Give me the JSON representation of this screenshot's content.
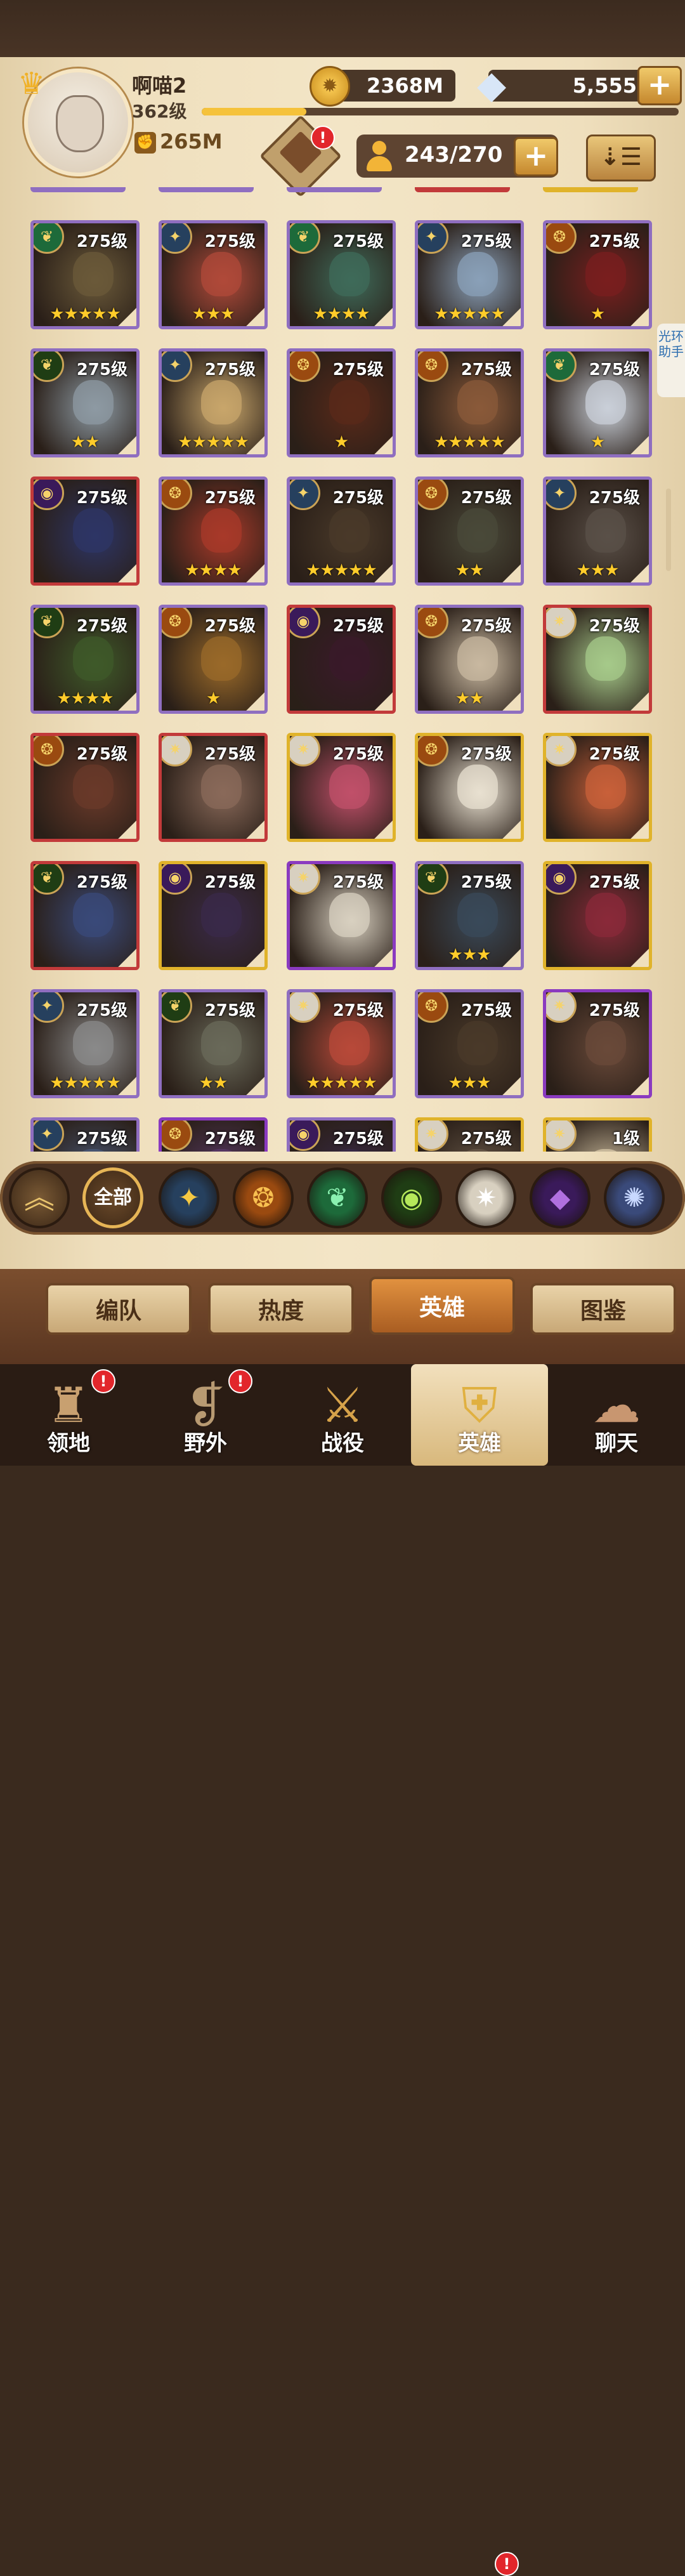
{
  "header": {
    "username": "啊喵2",
    "level": "362级",
    "xp_fraction": 0.22,
    "gold": "2368M",
    "gems": "5,555",
    "power": "265M",
    "hero_capacity": "243/270",
    "plus_symbol": "+",
    "alert_symbol": "!",
    "sort_symbol": "⇣☰"
  },
  "side_helper": "光环助手",
  "heroes": [
    {
      "level": "275级",
      "stars": "★★★★★",
      "faction": "verdant",
      "frame": "#8f6ec0",
      "art": "#6b5a3a"
    },
    {
      "level": "275级",
      "stars": "★★★",
      "faction": "celestial-blue",
      "frame": "#8f6ec0",
      "art": "#b04a3a"
    },
    {
      "level": "275级",
      "stars": "★★★★",
      "faction": "verdant",
      "frame": "#8f6ec0",
      "art": "#3f6b5a"
    },
    {
      "level": "275级",
      "stars": "★★★★★",
      "faction": "lightbearer",
      "frame": "#8f6ec0",
      "art": "#8aa0b8"
    },
    {
      "level": "275级",
      "stars": "★",
      "faction": "mauler",
      "frame": "#8f6ec0",
      "art": "#7a1f1f"
    },
    {
      "level": "275级",
      "stars": "★★",
      "faction": "wilder",
      "frame": "#8f6ec0",
      "art": "#8d9aa3"
    },
    {
      "level": "275级",
      "stars": "★★★★★",
      "faction": "lightbearer",
      "frame": "#8f6ec0",
      "art": "#c8a66b"
    },
    {
      "level": "275级",
      "stars": "★",
      "faction": "mauler",
      "frame": "#8f6ec0",
      "art": "#5a2a1a"
    },
    {
      "level": "275级",
      "stars": "★★★★★",
      "faction": "mauler",
      "frame": "#8f6ec0",
      "art": "#8a5a3a"
    },
    {
      "level": "275级",
      "stars": "★",
      "faction": "verdant",
      "frame": "#8f6ec0",
      "art": "#c9cfd8"
    },
    {
      "level": "275级",
      "stars": "",
      "faction": "graveborn",
      "frame": "#c23a3a",
      "art": "#2d3566"
    },
    {
      "level": "275级",
      "stars": "★★★★",
      "faction": "mauler",
      "frame": "#8f6ec0",
      "art": "#a83a2a"
    },
    {
      "level": "275级",
      "stars": "★★★★★",
      "faction": "lightbearer",
      "frame": "#8f6ec0",
      "art": "#4a3a2a"
    },
    {
      "level": "275级",
      "stars": "★★",
      "faction": "mauler",
      "frame": "#8f6ec0",
      "art": "#4a4a3a"
    },
    {
      "level": "275级",
      "stars": "★★★",
      "faction": "lightbearer",
      "frame": "#8f6ec0",
      "art": "#5a5048"
    },
    {
      "level": "275级",
      "stars": "★★★★",
      "faction": "wilder",
      "frame": "#8f6ec0",
      "art": "#3f5a2a"
    },
    {
      "level": "275级",
      "stars": "★",
      "faction": "mauler",
      "frame": "#8f6ec0",
      "art": "#9a6a2a"
    },
    {
      "level": "275级",
      "stars": "",
      "faction": "graveborn",
      "frame": "#c23a3a",
      "art": "#3a1a2a"
    },
    {
      "level": "275级",
      "stars": "★★",
      "faction": "mauler",
      "frame": "#8f6ec0",
      "art": "#c8b8a0"
    },
    {
      "level": "275级",
      "stars": "",
      "faction": "celestial",
      "frame": "#c23a3a",
      "art": "#a6c98a"
    },
    {
      "level": "275级",
      "stars": "",
      "faction": "mauler",
      "frame": "#c23a3a",
      "art": "#6a3a2a"
    },
    {
      "level": "275级",
      "stars": "",
      "faction": "celestial",
      "frame": "#c23a3a",
      "art": "#8a6a5a"
    },
    {
      "level": "275级",
      "stars": "",
      "faction": "celestial",
      "frame": "#e0b32a",
      "art": "#c0506a"
    },
    {
      "level": "275级",
      "stars": "",
      "faction": "mauler",
      "frame": "#e0b32a",
      "art": "#e8e0d0"
    },
    {
      "level": "275级",
      "stars": "",
      "faction": "celestial",
      "frame": "#e0b32a",
      "art": "#c8603a"
    },
    {
      "level": "275级",
      "stars": "",
      "faction": "wilder",
      "frame": "#c23a3a",
      "art": "#3a4a7a"
    },
    {
      "level": "275级",
      "stars": "",
      "faction": "graveborn",
      "frame": "#e0b32a",
      "art": "#3a2a4a"
    },
    {
      "level": "275级",
      "stars": "",
      "faction": "celestial",
      "frame": "#8a3ac0",
      "art": "#d8d0c0"
    },
    {
      "level": "275级",
      "stars": "★★★",
      "faction": "wilder",
      "frame": "#8f6ec0",
      "art": "#3a4a5a"
    },
    {
      "level": "275级",
      "stars": "",
      "faction": "graveborn",
      "frame": "#e0b32a",
      "art": "#8a2a3a"
    },
    {
      "level": "275级",
      "stars": "★★★★★",
      "faction": "lightbearer",
      "frame": "#8f6ec0",
      "art": "#8a8a8a"
    },
    {
      "level": "275级",
      "stars": "★★",
      "faction": "wilder",
      "frame": "#8f6ec0",
      "art": "#6a6a5a"
    },
    {
      "level": "275级",
      "stars": "★★★★★",
      "faction": "celestial",
      "frame": "#8f6ec0",
      "art": "#b84a3a"
    },
    {
      "level": "275级",
      "stars": "★★★",
      "faction": "mauler",
      "frame": "#8f6ec0",
      "art": "#4a3a2a"
    },
    {
      "level": "275级",
      "stars": "",
      "faction": "celestial",
      "frame": "#8a3ac0",
      "art": "#6a4a3a"
    },
    {
      "level": "275级",
      "stars": "",
      "faction": "lightbearer",
      "frame": "#8f6ec0",
      "art": "#4a5a7a"
    },
    {
      "level": "275级",
      "stars": "",
      "faction": "mauler",
      "frame": "#8a3ac0",
      "art": "#5a3a6a"
    },
    {
      "level": "275级",
      "stars": "",
      "faction": "graveborn",
      "frame": "#8f6ec0",
      "art": "#3a2a4a"
    },
    {
      "level": "275级",
      "stars": "",
      "faction": "celestial",
      "frame": "#e0b32a",
      "art": "#6a5a4a"
    },
    {
      "level": "1级",
      "stars": "",
      "faction": "celestial",
      "frame": "#e0b32a",
      "art": "#d8c8a8"
    }
  ],
  "faction_filters": {
    "up": "︽",
    "all_label": "全部",
    "icons": [
      {
        "name": "lightbearer",
        "glyph": "✦",
        "bg": "#26405e",
        "fg": "#f5c842"
      },
      {
        "name": "mauler",
        "glyph": "❂",
        "bg": "#9a4a10",
        "fg": "#f8c050"
      },
      {
        "name": "wilder",
        "glyph": "❦",
        "bg": "#1d6a3a",
        "fg": "#8af0b0"
      },
      {
        "name": "graveborn",
        "glyph": "◉",
        "bg": "#1f3d14",
        "fg": "#b6e85a"
      },
      {
        "name": "celestial",
        "glyph": "✷",
        "bg": "#d8d0c0",
        "fg": "#ffffff"
      },
      {
        "name": "hypogean",
        "glyph": "◆",
        "bg": "#3a1a5a",
        "fg": "#b070e0"
      },
      {
        "name": "dimensional",
        "glyph": "✺",
        "bg": "#3a4a7a",
        "fg": "#c8d8ff"
      }
    ]
  },
  "tabs": [
    "编队",
    "热度",
    "英雄",
    "图鉴"
  ],
  "active_tab": "英雄",
  "nav": [
    {
      "label": "领地",
      "icon": "castle-icon",
      "alert": true
    },
    {
      "label": "野外",
      "icon": "scroll-map-icon",
      "alert": true
    },
    {
      "label": "战役",
      "icon": "crossed-swords-icon",
      "alert": false
    },
    {
      "label": "英雄",
      "icon": "helmet-icon",
      "alert": false
    },
    {
      "label": "聊天",
      "icon": "chat-bubble-icon",
      "alert": false
    }
  ],
  "active_nav": "英雄",
  "faction_glyphs": {
    "lightbearer": "✦",
    "mauler": "❂",
    "wilder": "❦",
    "graveborn": "◉",
    "celestial": "✷",
    "hypogean": "◆",
    "celestial-blue": "✦",
    "verdant": "❦"
  },
  "faction_colors": {
    "lightbearer": "#26405e",
    "mauler": "#9a4a10",
    "wilder": "#1f3d14",
    "graveborn": "#3a1a5a",
    "celestial": "#d8d0c0",
    "celestial-blue": "#26405e",
    "verdant": "#1d6a3a",
    "hypogean": "#3a1a5a"
  }
}
